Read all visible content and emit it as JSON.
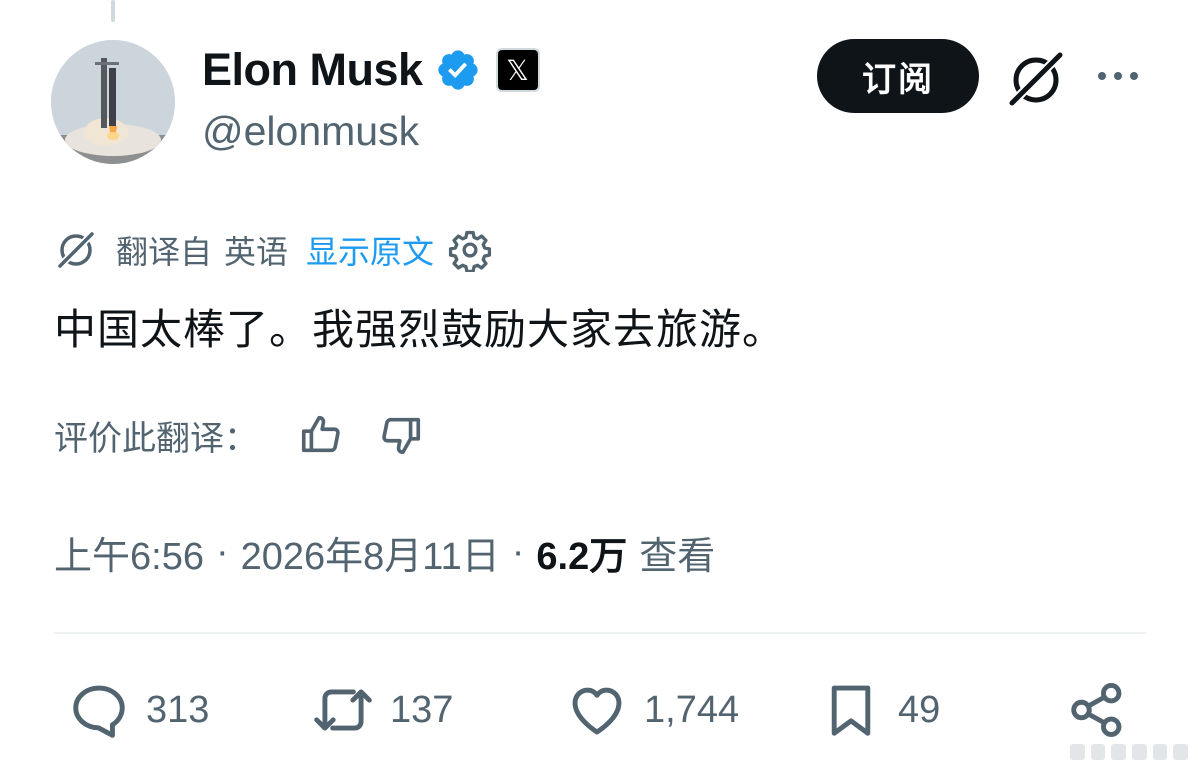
{
  "author": {
    "display_name": "Elon Musk",
    "handle": "@elonmusk",
    "verified": true,
    "affiliation_badge": "𝕏"
  },
  "header": {
    "subscribe_label": "订阅",
    "icons": [
      "grok-icon",
      "more-icon"
    ]
  },
  "translation": {
    "translated_from": "翻译自",
    "language": "英语",
    "show_original": "显示原文"
  },
  "tweet": {
    "text": "中国太棒了。我强烈鼓励大家去旅游。"
  },
  "rating": {
    "label": "评价此翻译："
  },
  "meta": {
    "time": "上午6:56",
    "separator": "·",
    "date": "2026年8月11日",
    "views_count": "6.2万",
    "views_label": "查看"
  },
  "actions": {
    "replies": "313",
    "retweets": "137",
    "likes": "1,744",
    "bookmarks": "49"
  },
  "colors": {
    "link_blue": "#1d9bf0",
    "verified_blue": "#1d9bf0",
    "text_primary": "#0f1419",
    "text_secondary": "#536471",
    "divider": "#eff3f4"
  }
}
